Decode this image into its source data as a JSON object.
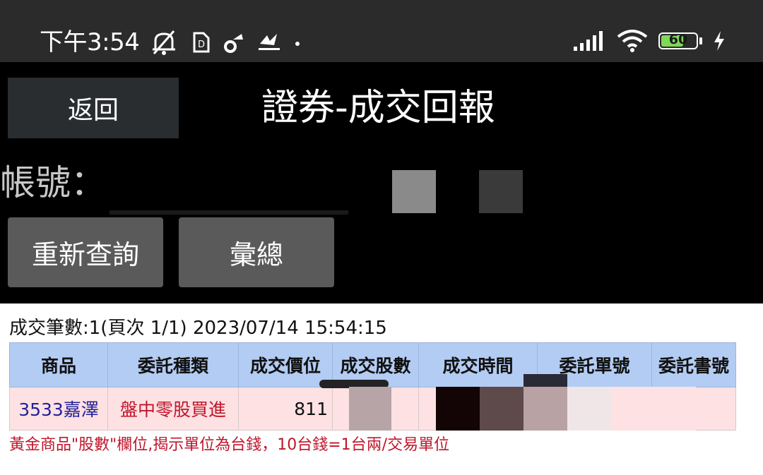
{
  "status_bar": {
    "time": "下午3:54",
    "battery_percent": "60",
    "icons_left": [
      "mute-icon",
      "sim-icon",
      "settings-icon",
      "capital-app-icon",
      "dot-icon"
    ],
    "icons_right": [
      "signal-icon",
      "wifi-icon",
      "battery-icon",
      "charging-icon"
    ]
  },
  "header": {
    "back_label": "返回",
    "title": "證券-成交回報"
  },
  "account": {
    "label": "帳號："
  },
  "actions": {
    "requery_label": "重新查詢",
    "summary_label": "彙總"
  },
  "results": {
    "count_text": "成交筆數:1(頁次 1/1) 2023/07/14 15:54:15",
    "columns": [
      "商品",
      "委託種類",
      "成交價位",
      "成交股數",
      "成交時間",
      "委託單號",
      "委託書號"
    ],
    "rows": [
      {
        "product": "3533嘉澤",
        "order_type": "盤中零股買進",
        "price": "811"
      }
    ],
    "notice": "黃金商品\"股數\"欄位,揭示單位為台錢，10台錢=1台兩/交易單位"
  },
  "colors": {
    "header_bg": "#b3ccf3",
    "row_bg": "#fde1e3",
    "product_text": "#22229a",
    "order_type_text": "#c0152b",
    "notice_text": "#c0152b",
    "battery_fill": "#7ed957"
  }
}
